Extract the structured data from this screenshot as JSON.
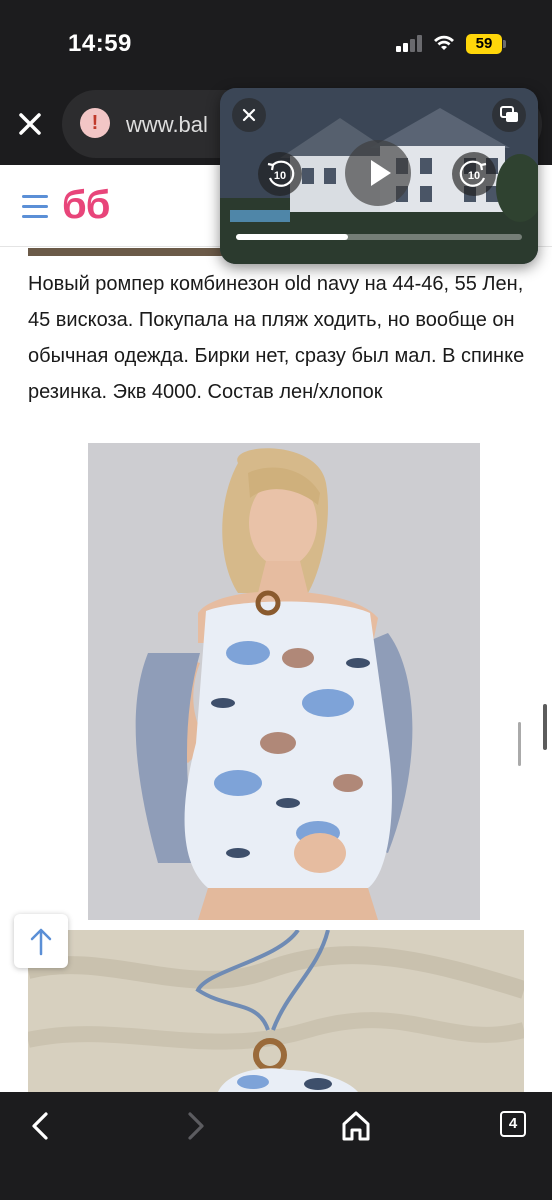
{
  "status_bar": {
    "time": "14:59",
    "battery": "59",
    "icons": [
      "signal-icon",
      "wifi-icon",
      "battery-icon"
    ]
  },
  "browser": {
    "url": "www.bal",
    "icons": [
      "close-icon",
      "warning-icon"
    ]
  },
  "site": {
    "logo": "бб",
    "menu_icon": "menu-icon"
  },
  "post": {
    "text": "Новый ромпер комбинезон old navy на 44-46, 55 Лен, 45 вискоза. Покупала на пляж ходить, но вообще он обычная одежда. Бирки нет, сразу был мал. В спинке резинка. Экв 4000. Состав лен/хлопок"
  },
  "pip": {
    "skip_back": "10",
    "skip_forward": "10",
    "progress": 0.39,
    "icons": [
      "close-icon",
      "expand-icon",
      "rewind-icon",
      "play-icon",
      "forward-icon"
    ]
  },
  "scroll_top_icon": "arrow-up-icon",
  "toolbar": {
    "tabs_count": "4",
    "icons": [
      "back-icon",
      "forward-icon",
      "home-icon",
      "tabs-icon"
    ]
  },
  "colors": {
    "logo": "#e8457a",
    "menu": "#5b8fd6",
    "battery": "#ffd60a",
    "bar": "#1c1c1e"
  }
}
